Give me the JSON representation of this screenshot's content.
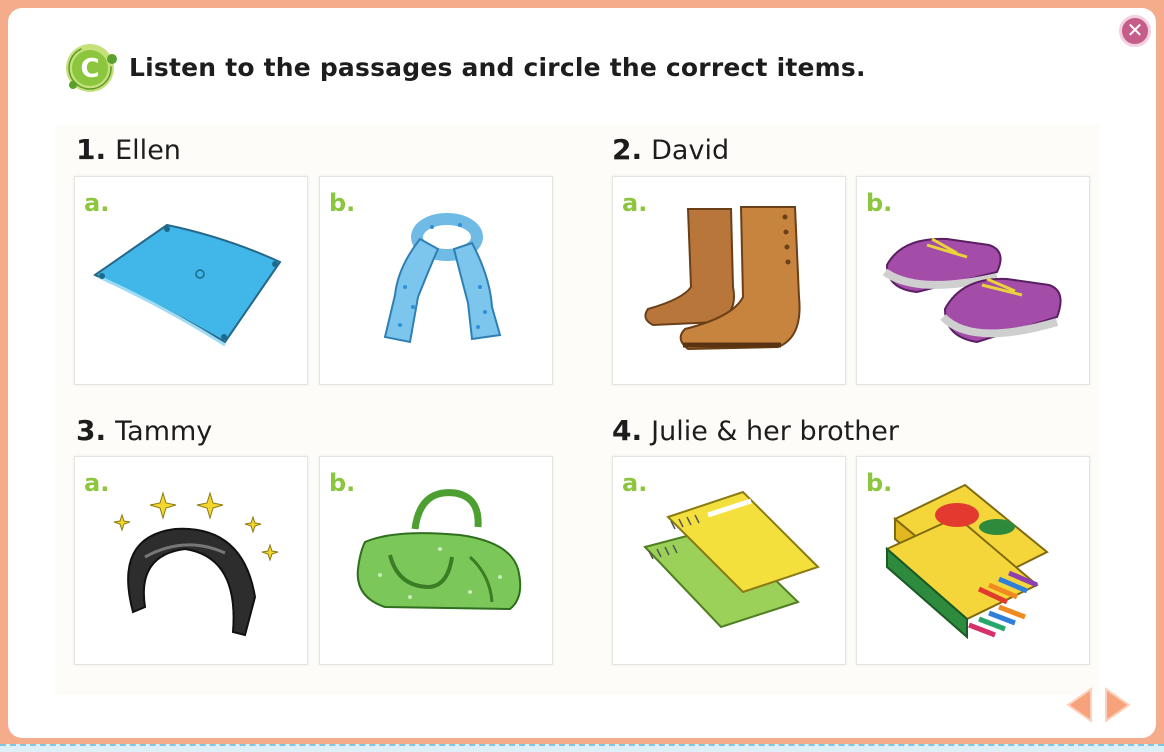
{
  "header": {
    "badge_letter": "C",
    "title": "Listen to the passages and circle the correct items."
  },
  "questions": [
    {
      "number": "1.",
      "name": "Ellen",
      "items": [
        {
          "letter": "a.",
          "icon": "blanket-icon"
        },
        {
          "letter": "b.",
          "icon": "scarf-icon"
        }
      ]
    },
    {
      "number": "2.",
      "name": "David",
      "items": [
        {
          "letter": "a.",
          "icon": "boots-icon"
        },
        {
          "letter": "b.",
          "icon": "sneakers-icon"
        }
      ]
    },
    {
      "number": "3.",
      "name": "Tammy",
      "items": [
        {
          "letter": "a.",
          "icon": "headband-icon"
        },
        {
          "letter": "b.",
          "icon": "handbag-icon"
        }
      ]
    },
    {
      "number": "4.",
      "name": "Julie & her brother",
      "items": [
        {
          "letter": "a.",
          "icon": "notebooks-icon"
        },
        {
          "letter": "b.",
          "icon": "crayons-icon"
        }
      ]
    }
  ],
  "controls": {
    "close_icon": "close-icon",
    "prev_icon": "arrow-left-icon",
    "next_icon": "arrow-right-icon"
  },
  "colors": {
    "frame": "#f4ac8b",
    "accent_green": "#8cc63f",
    "arrow": "#f7a27a",
    "close": "#c45d8a"
  }
}
